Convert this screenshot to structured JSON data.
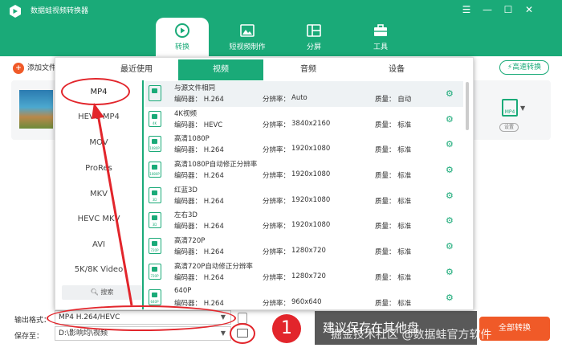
{
  "app": {
    "title": "数据蛙视频转换器",
    "window_controls": [
      "☰",
      "—",
      "☐",
      "✕"
    ]
  },
  "nav": {
    "tabs": [
      {
        "label": "转换"
      },
      {
        "label": "短视频制作"
      },
      {
        "label": "分屏"
      },
      {
        "label": "工具"
      }
    ]
  },
  "toolbar": {
    "add_file": "添加文件",
    "speed_convert": "高速转换"
  },
  "file_card": {
    "format_badge": "MP4",
    "settings": "设置"
  },
  "popup": {
    "tabs": [
      "最近使用",
      "视频",
      "音频",
      "设备"
    ],
    "categories": [
      "MP4",
      "HEVC MP4",
      "MOV",
      "ProRes",
      "MKV",
      "HEVC MKV",
      "AVI",
      "5K/8K Video"
    ],
    "search": "搜索",
    "formats": [
      {
        "name": "与源文件相同",
        "codec": "编码器： H.264",
        "res_label": "分辨率：",
        "res": "Auto",
        "quality": "质量： 自动",
        "tag": ""
      },
      {
        "name": "4K视频",
        "codec": "编码器： HEVC",
        "res_label": "分辨率：",
        "res": "3840x2160",
        "quality": "质量： 标准",
        "tag": "4K"
      },
      {
        "name": "高清1080P",
        "codec": "编码器： H.264",
        "res_label": "分辨率：",
        "res": "1920x1080",
        "quality": "质量： 标准",
        "tag": "1080P"
      },
      {
        "name": "高清1080P自动修正分辨率",
        "codec": "编码器： H.264",
        "res_label": "分辨率：",
        "res": "1920x1080",
        "quality": "质量： 标准",
        "tag": "1080P"
      },
      {
        "name": "红蓝3D",
        "codec": "编码器： H.264",
        "res_label": "分辨率：",
        "res": "1920x1080",
        "quality": "质量： 标准",
        "tag": "3D"
      },
      {
        "name": "左右3D",
        "codec": "编码器： H.264",
        "res_label": "分辨率：",
        "res": "1920x1080",
        "quality": "质量： 标准",
        "tag": "3D"
      },
      {
        "name": "高清720P",
        "codec": "编码器： H.264",
        "res_label": "分辨率：",
        "res": "1280x720",
        "quality": "质量： 标准",
        "tag": "720P"
      },
      {
        "name": "高清720P自动修正分辨率",
        "codec": "编码器： H.264",
        "res_label": "分辨率：",
        "res": "1280x720",
        "quality": "质量： 标准",
        "tag": "720P"
      },
      {
        "name": "640P",
        "codec": "编码器： H.264",
        "res_label": "分辨率：",
        "res": "960x640",
        "quality": "质量： 标准",
        "tag": "640P"
      }
    ]
  },
  "bottom": {
    "output_label": "输出格式：",
    "output_value": "MP4 H.264/HEVC",
    "save_label": "保存至：",
    "save_path": "D:\\影响均\\视频",
    "convert_all": "全部转换"
  },
  "annotation": {
    "number": "1",
    "tip": "建议保存在其他盘",
    "watermark": "掘金技术社区 @数据蛙官方软件"
  },
  "colors": {
    "brand": "#1aaa78",
    "accent": "#f05a28",
    "annotation": "#e2252b"
  }
}
